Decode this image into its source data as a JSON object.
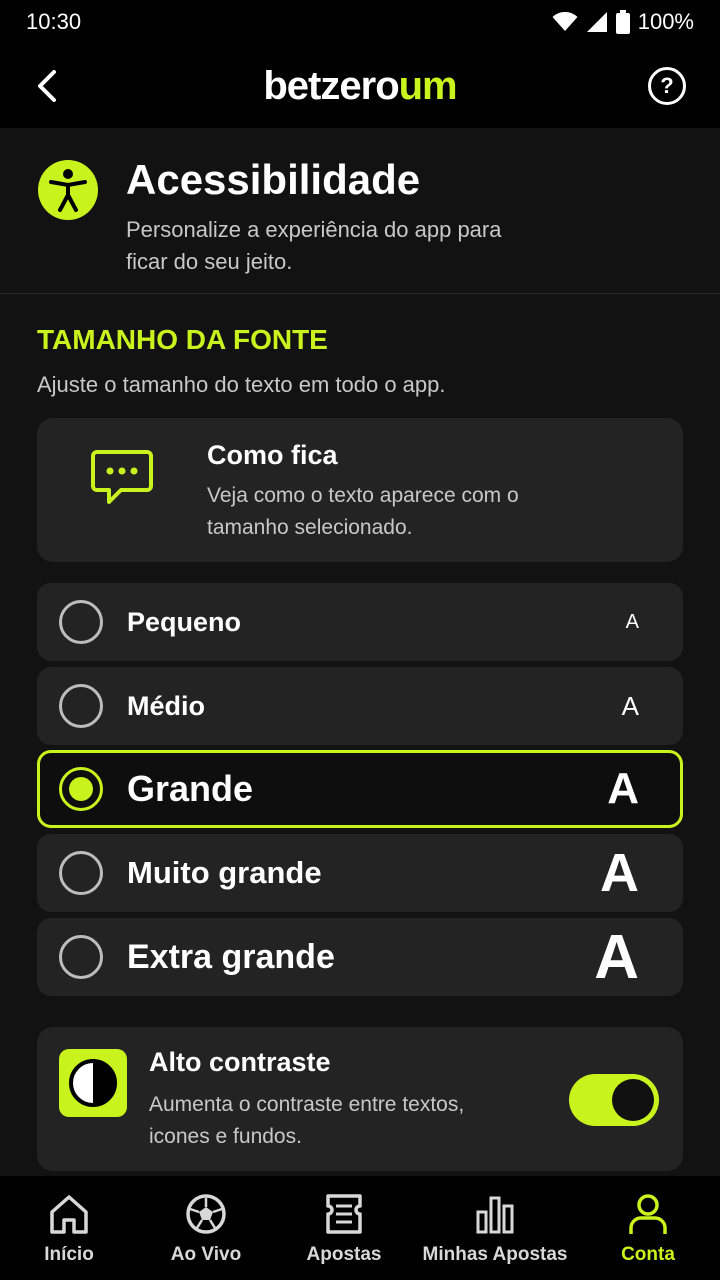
{
  "status_bar": {
    "time": "10:30",
    "battery": "100%"
  },
  "header": {
    "logo_part1": "betzero",
    "logo_part2": "um",
    "help_label": "?"
  },
  "intro": {
    "title": "Acessibilidade",
    "subtitle": "Personalize a experiência do app para ficar do seu jeito."
  },
  "font_section": {
    "title": "TAMANHO DA FONTE",
    "subtitle": "Ajuste o tamanho do texto em todo o app.",
    "preview": {
      "title": "Como fica",
      "subtitle": "Veja como o texto aparece com o tamanho selecionado."
    },
    "options": [
      {
        "label": "Pequeno",
        "sample": "A",
        "selected": false
      },
      {
        "label": "Médio",
        "sample": "A",
        "selected": false
      },
      {
        "label": "Grande",
        "sample": "A",
        "selected": true
      },
      {
        "label": "Muito grande",
        "sample": "A",
        "selected": false
      },
      {
        "label": "Extra grande",
        "sample": "A",
        "selected": false
      }
    ]
  },
  "contrast": {
    "title": "Alto contraste",
    "subtitle": "Aumenta o contraste entre textos, icones e fundos.",
    "enabled": true
  },
  "bottom_nav": {
    "items": [
      {
        "label": "Início",
        "icon": "home-icon",
        "active": false
      },
      {
        "label": "Ao Vivo",
        "icon": "soccer-ball-icon",
        "active": false
      },
      {
        "label": "Apostas",
        "icon": "ticket-icon",
        "active": false
      },
      {
        "label": "Minhas Apostas",
        "icon": "bar-chart-icon",
        "active": false
      },
      {
        "label": "Conta",
        "icon": "user-icon",
        "active": true
      }
    ]
  },
  "colors": {
    "accent": "#c8f31d",
    "background": "#121212",
    "card": "#232323"
  }
}
